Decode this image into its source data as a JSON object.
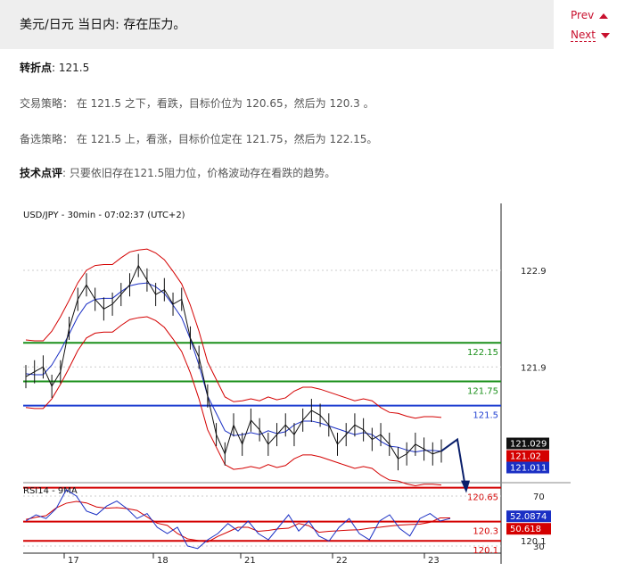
{
  "header": {
    "title": "美元/日元 当日内: 存在压力。",
    "prev_label": "Prev",
    "next_label": "Next"
  },
  "article": {
    "pivot_label": "转折点",
    "pivot_value": ": 121.5",
    "strategy_label": "交易策略：",
    "strategy_text": "在 121.5 之下，看跌，目标价位为 120.65，然后为 120.3 。",
    "alt_label": "备选策略：",
    "alt_text": "在 121.5 上，看涨，目标价位定在 121.75，然后为 122.15。",
    "comment_label": "技术点评",
    "comment_text": ": 只要依旧存在121.5阻力位，价格波动存在看跌的趋势。"
  },
  "chart_data": {
    "type": "line",
    "title": "USD/JPY - 30min - 07:02:37 (UTC+2)",
    "price_axis_ticks": [
      122.9,
      121.9,
      120.1
    ],
    "x_tick_labels": [
      "17",
      "18",
      "21",
      "22",
      "23"
    ],
    "levels": [
      {
        "value": 122.15,
        "label": "122.15",
        "color": "#1a8f1a"
      },
      {
        "value": 121.75,
        "label": "121.75",
        "color": "#1a8f1a"
      },
      {
        "value": 121.5,
        "label": "121.5",
        "color": "#1f3fd1"
      },
      {
        "value": 120.65,
        "label": "120.65",
        "color": "#d40000"
      },
      {
        "value": 120.3,
        "label": "120.3",
        "color": "#d40000"
      },
      {
        "value": 120.1,
        "label": "120.1",
        "color": "#d40000"
      }
    ],
    "price_tags": [
      {
        "label": "121.029",
        "bg": "#111111"
      },
      {
        "label": "121.02",
        "bg": "#d40000"
      },
      {
        "label": "121.011",
        "bg": "#1a2fc4"
      }
    ],
    "price_series": [
      121.8,
      121.85,
      121.9,
      121.7,
      121.85,
      122.3,
      122.6,
      122.75,
      122.6,
      122.5,
      122.55,
      122.65,
      122.75,
      122.95,
      122.8,
      122.65,
      122.7,
      122.55,
      122.6,
      122.2,
      122.0,
      121.6,
      121.2,
      121.0,
      121.3,
      121.1,
      121.35,
      121.25,
      121.1,
      121.2,
      121.3,
      121.2,
      121.35,
      121.45,
      121.4,
      121.3,
      121.1,
      121.2,
      121.3,
      121.25,
      121.15,
      121.2,
      121.1,
      120.95,
      121.0,
      121.1,
      121.05,
      121.0,
      121.03
    ],
    "forecast": [
      121.15,
      120.65
    ],
    "rsi": {
      "title": "RSI14 - 9MA",
      "ticks": [
        70,
        30
      ],
      "tags": [
        {
          "label": "52.0874",
          "bg": "#1a2fc4"
        },
        {
          "label": "50.618",
          "bg": "#d40000"
        }
      ],
      "rsi_series": [
        50,
        55,
        52,
        60,
        75,
        70,
        58,
        55,
        62,
        66,
        60,
        52,
        56,
        45,
        40,
        45,
        30,
        28,
        35,
        40,
        48,
        42,
        50,
        40,
        35,
        45,
        55,
        42,
        50,
        38,
        34,
        45,
        52,
        40,
        35,
        50,
        55,
        44,
        38,
        52,
        56,
        50,
        52
      ]
    }
  }
}
